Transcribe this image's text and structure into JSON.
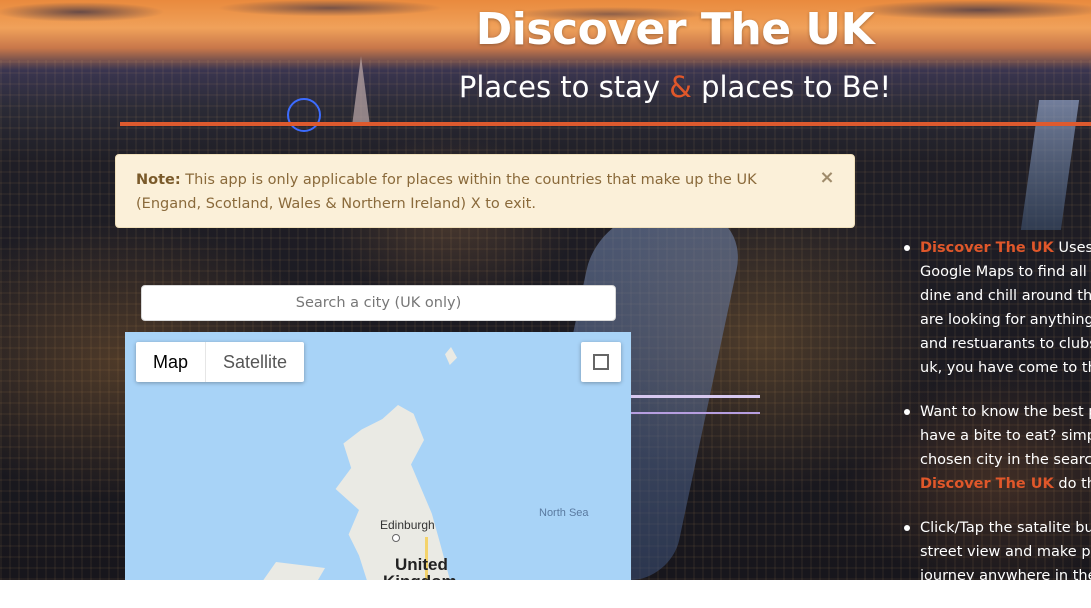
{
  "header": {
    "title": "Discover The UK",
    "subtitle_pre": "Places to stay ",
    "subtitle_amp": "&",
    "subtitle_post": " places to Be!"
  },
  "alert": {
    "label": "Note:",
    "text": "This app is only applicable for places within the countries that make up the UK (Engand, Scotland, Wales & Northern Ireland) X to exit.",
    "close": "×"
  },
  "search": {
    "placeholder": "Search a city (UK only)"
  },
  "map": {
    "toggle_map": "Map",
    "toggle_satellite": "Satellite",
    "labels": {
      "sea": "North Sea",
      "city": "Edinburgh",
      "country_line1": "United",
      "country_line2": "Kingdom"
    }
  },
  "info": {
    "items": [
      {
        "brand": "Discover The UK",
        "line1": " Uses t",
        "lines": [
          "Google Maps to find all",
          "dine and chill around the",
          "are looking for anything",
          "and restuarants to clubs",
          "uk, you have come to th"
        ]
      },
      {
        "lines_pre": [
          "Want to know the best p",
          "have a bite to eat? simpl",
          "chosen city in the search"
        ],
        "brand": "Discover The UK",
        "line_end": " do the"
      },
      {
        "lines": [
          "Click/Tap the satalite bu",
          "street view and make pl",
          "journey anywhere in the"
        ]
      }
    ]
  },
  "colors": {
    "accent": "#e0572a",
    "alert_bg": "#fbf0d9",
    "map_water": "#a8d3f7"
  }
}
